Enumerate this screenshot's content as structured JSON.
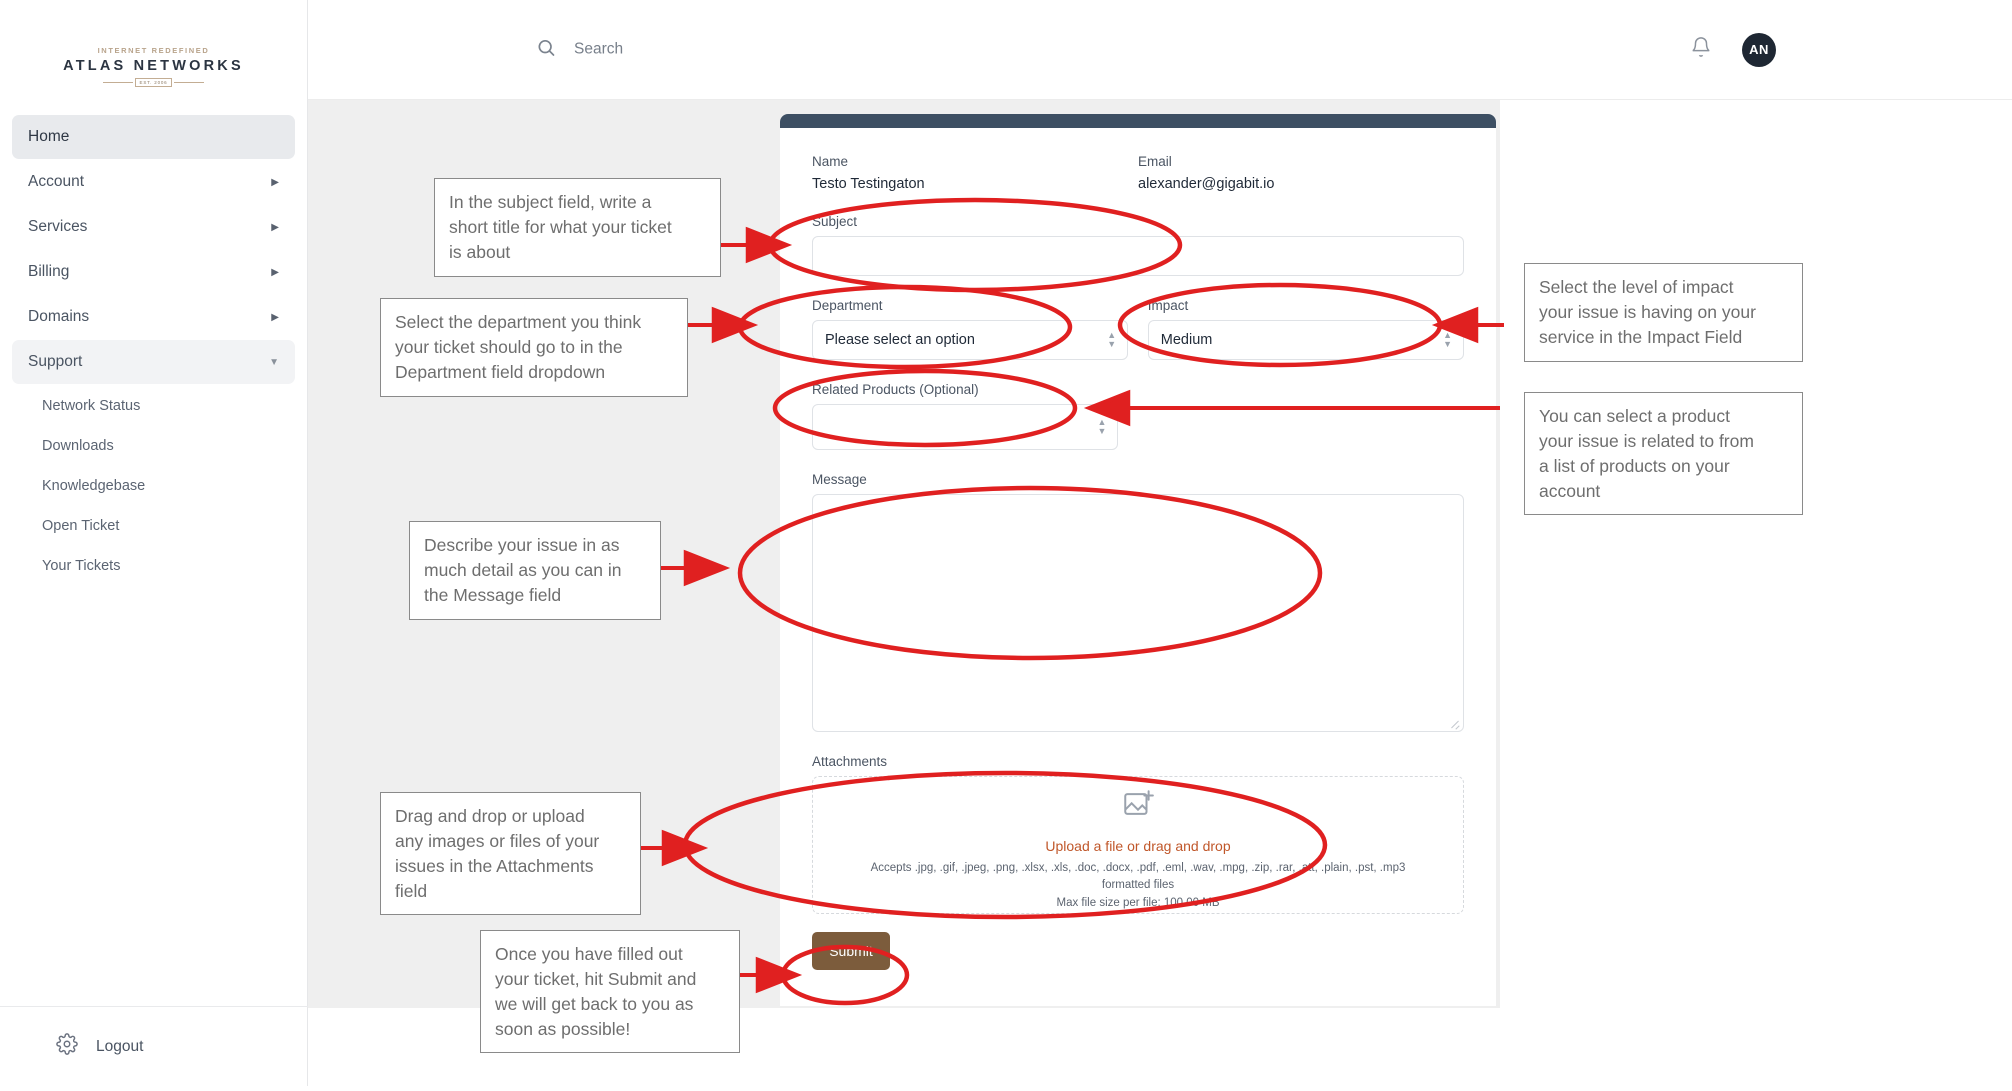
{
  "brand": {
    "logo_arc": "INTERNET REDEFINED",
    "logo_name": "ATLAS NETWORKS",
    "logo_est": "EST. 2006"
  },
  "sidebar": {
    "items": [
      {
        "label": "Home",
        "state": "active",
        "caret": ""
      },
      {
        "label": "Account",
        "state": "default",
        "caret": "▶"
      },
      {
        "label": "Services",
        "state": "default",
        "caret": "▶"
      },
      {
        "label": "Billing",
        "state": "default",
        "caret": "▶"
      },
      {
        "label": "Domains",
        "state": "default",
        "caret": "▶"
      },
      {
        "label": "Support",
        "state": "expanded",
        "caret": "▼"
      }
    ],
    "subitems": [
      {
        "label": "Network Status"
      },
      {
        "label": "Downloads"
      },
      {
        "label": "Knowledgebase"
      },
      {
        "label": "Open Ticket"
      },
      {
        "label": "Your Tickets"
      }
    ],
    "logout_label": "Logout",
    "logout_icon": "gear-icon"
  },
  "topbar": {
    "search_placeholder": "Search",
    "search_icon": "search-icon",
    "bell_icon": "bell-icon",
    "avatar_initials": "AN"
  },
  "form": {
    "name_label": "Name",
    "name_value": "Testo Testingaton",
    "email_label": "Email",
    "email_value": "alexander@gigabit.io",
    "subject_label": "Subject",
    "subject_value": "",
    "department_label": "Department",
    "department_value": "Please select an option",
    "impact_label": "Impact",
    "impact_value": "Medium",
    "related_label": "Related Products (Optional)",
    "related_value": "",
    "message_label": "Message",
    "message_value": "",
    "attachments_label": "Attachments",
    "upload_cta": "Upload a file or drag and drop",
    "accepts_text": "Accepts .jpg, .gif, .jpeg, .png, .xlsx, .xls, .doc, .docx, .pdf, .eml, .wav, .mpg, .zip, .rar, .att, .plain, .pst, .mp3 formatted files",
    "max_size_text": "Max file size per file: 100.00 MB",
    "submit_label": "Submit"
  },
  "annotations": {
    "accent_color": "#e02020",
    "subject": "In the subject field, write a\nshort title for what your ticket\nis about",
    "department": "Select the department you think\nyour ticket should go to in the\nDepartment field dropdown",
    "impact": "Select the level of impact\nyour issue is having on your\nservice in the Impact Field",
    "related": "You can select a product\nyour issue is related to from\na list of products on your\naccount",
    "message": "Describe your issue in as\nmuch detail as you can in\nthe Message field",
    "attachments": "Drag and drop or upload\nany images or files of your\nissues in the Attachments\nfield",
    "submit": "Once you have filled out\nyour ticket, hit Submit and\nwe will get back to you as\nsoon as possible!"
  },
  "theme": {
    "card_header": "#3d4f63",
    "submit_bg": "#7c5c3c",
    "content_bg": "#efefef",
    "upload_link": "#c0572a"
  }
}
